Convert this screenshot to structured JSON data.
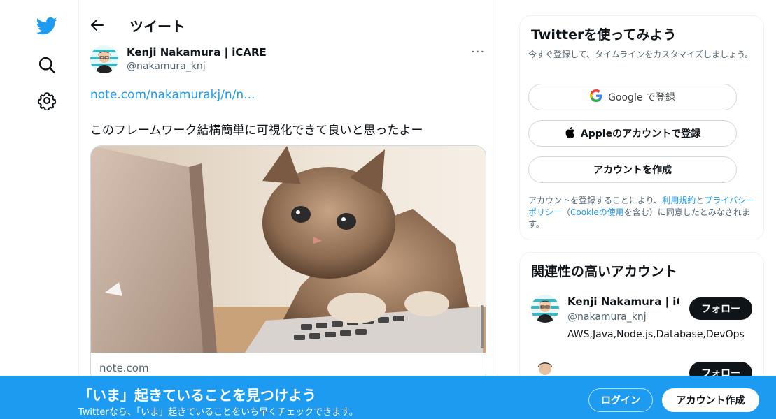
{
  "colors": {
    "brand": "#1d9bf0",
    "text": "#0f1419",
    "secondary": "#536471",
    "border": "#cfd9de"
  },
  "nav": {
    "icons": [
      "twitter-bird-icon",
      "search-icon",
      "gear-icon"
    ]
  },
  "header": {
    "title": "ツイート"
  },
  "tweet": {
    "author_name": "Kenji Nakamura | iCARE",
    "author_handle": "@nakamura_knj",
    "more_label": "···",
    "link": "note.com/nakamurakj/n/n...",
    "text": "このフレームワーク結構簡単に可視化できて良いと思ったよー",
    "card": {
      "domain": "note.com"
    }
  },
  "signup_box": {
    "title": "Twitterを使ってみよう",
    "subtitle": "今すぐ登録して、タイムラインをカスタマイズしましょう。",
    "google_label": "Google で登録",
    "apple_label": "Appleのアカウントで登録",
    "create_label": "アカウントを作成",
    "terms_prefix": "アカウントを登録することにより、",
    "terms_link1": "利用規約",
    "terms_and": "と",
    "terms_link2": "プライバシーポリシー",
    "terms_mid": "（",
    "terms_link3": "Cookieの使用",
    "terms_suffix": "を含む）に同意したとみなされます。"
  },
  "relevant": {
    "title": "関連性の高いアカウント",
    "users": [
      {
        "name": "Kenji Nakamura | iC...",
        "handle": "@nakamura_knj",
        "bio": "AWS,Java,Node.js,Database,DevOps",
        "follow_label": "フォロー"
      },
      {
        "follow_label": "フォロー"
      }
    ]
  },
  "banner": {
    "title": "「いま」起きていることを見つけよう",
    "subtitle": "Twitterなら、「いま」起きていることをいち早くチェックできます。",
    "login_label": "ログイン",
    "signup_label": "アカウント作成"
  }
}
